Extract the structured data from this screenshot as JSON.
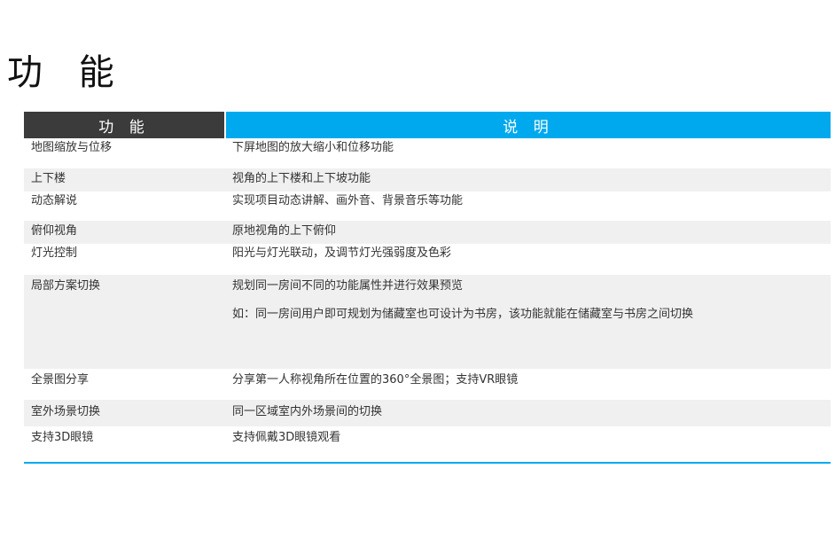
{
  "title": "功 能",
  "table": {
    "header": {
      "feature": "功 能",
      "description": "说 明"
    },
    "rows": [
      {
        "feature": "地图缩放与位移",
        "description": [
          "下屏地图的放大缩小和位移功能"
        ]
      },
      {
        "feature": "上下楼",
        "description": [
          "视角的上下楼和上下坡功能"
        ]
      },
      {
        "feature": "动态解说",
        "description": [
          "实现项目动态讲解、画外音、背景音乐等功能"
        ]
      },
      {
        "feature": "俯仰视角",
        "description": [
          "原地视角的上下俯仰"
        ]
      },
      {
        "feature": "灯光控制",
        "description": [
          "阳光与灯光联动，及调节灯光强弱度及色彩"
        ]
      },
      {
        "feature": "局部方案切换",
        "description": [
          "规划同一房间不同的功能属性并进行效果预览",
          "如：同一房间用户即可规划为储藏室也可设计为书房，该功能就能在储藏室与书房之间切换"
        ]
      },
      {
        "feature": "全景图分享",
        "description": [
          "分享第一人称视角所在位置的360°全景图；支持VR眼镜"
        ]
      },
      {
        "feature": "室外场景切换",
        "description": [
          "同一区域室内外场景间的切换"
        ]
      },
      {
        "feature": "支持3D眼镜",
        "description": [
          "支持佩戴3D眼镜观看"
        ]
      }
    ]
  }
}
